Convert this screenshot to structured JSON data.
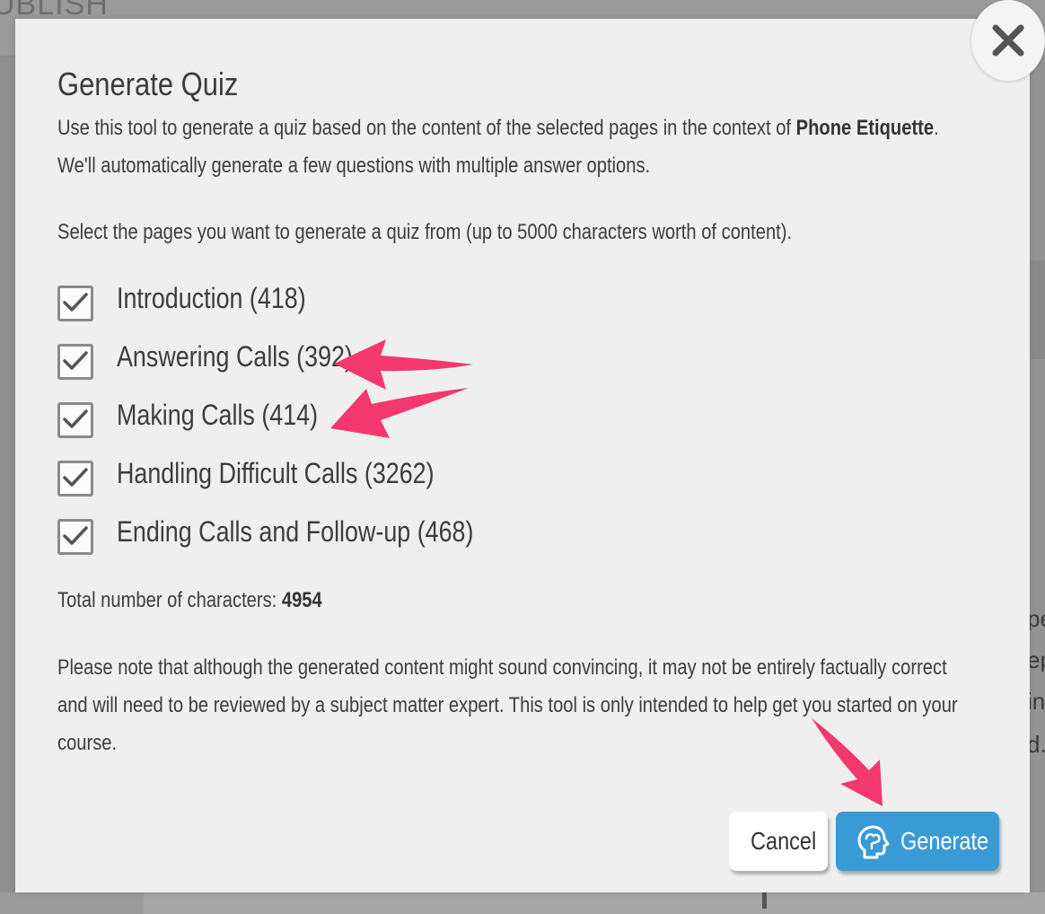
{
  "background": {
    "topbar_text": "UBLISH",
    "right_fragments": [
      "pe",
      "ep",
      "in",
      "d."
    ]
  },
  "modal": {
    "title": "Generate Quiz",
    "intro_line1_prefix": "Use this tool to generate a quiz based on the content of the selected pages in the context of ",
    "course_name": "Phone Etiquette",
    "intro_line1_suffix": ".",
    "intro_line2": "We'll automatically generate a few questions with multiple answer options.",
    "select_instruction": "Select the pages you want to generate a quiz from (up to 5000 characters worth of content).",
    "pages": [
      {
        "label": "Introduction (418)",
        "checked": true
      },
      {
        "label": "Answering Calls (392)",
        "checked": true
      },
      {
        "label": "Making Calls (414)",
        "checked": true
      },
      {
        "label": "Handling Difficult Calls (3262)",
        "checked": true
      },
      {
        "label": "Ending Calls and Follow-up (468)",
        "checked": true
      }
    ],
    "total_label": "Total number of characters: ",
    "total_value": "4954",
    "disclaimer_line1": "Please note that although the generated content might sound convincing, it may not be entirely factually correct",
    "disclaimer_line2": "and will need to be reviewed by a subject matter expert. This tool is only intended to help get you started on your",
    "disclaimer_line3": "course.",
    "cancel_label": "Cancel",
    "generate_label": "Generate"
  },
  "colors": {
    "primary": "#3a9ad6",
    "annotation_arrow": "#f2386f",
    "overlay": "#8f8f8f"
  }
}
